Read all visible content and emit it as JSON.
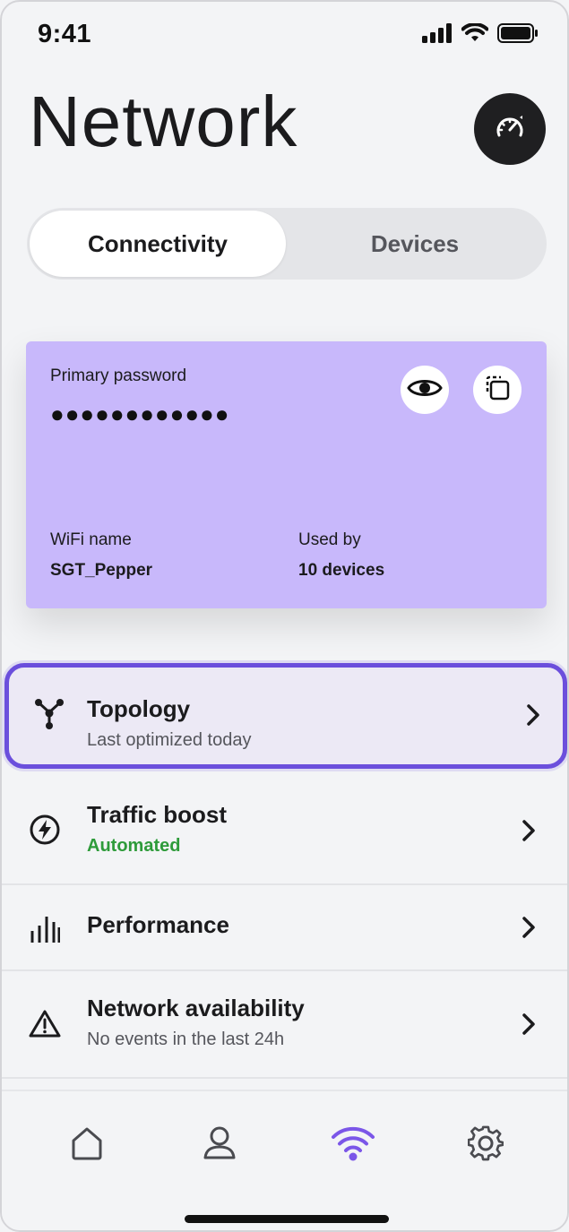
{
  "status_bar": {
    "time": "9:41",
    "signal_icon": "cellular-signal-icon",
    "wifi_icon": "wifi-icon",
    "battery_icon": "battery-icon"
  },
  "header": {
    "title": "Network",
    "speed_button_icon": "speedometer-icon"
  },
  "segmented": {
    "tabs": [
      {
        "label": "Connectivity",
        "active": true
      },
      {
        "label": "Devices",
        "active": false
      }
    ]
  },
  "password_card": {
    "background": "#c8b8fb",
    "password_label": "Primary password",
    "password_mask": "●●●●●●●●●●●●",
    "show_icon": "eye-icon",
    "copy_icon": "copy-icon",
    "wifi_name_label": "WiFi name",
    "wifi_name": "SGT_Pepper",
    "used_by_label": "Used by",
    "used_by_value": "10 devices"
  },
  "list": [
    {
      "id": "topology",
      "icon": "topology-icon",
      "title": "Topology",
      "subtitle": "Last optimized today",
      "subtitle_color": "#55565c",
      "selected": true
    },
    {
      "id": "traffic-boost",
      "icon": "lightning-icon",
      "title": "Traffic boost",
      "subtitle": "Automated",
      "subtitle_color": "#2e9b3a"
    },
    {
      "id": "performance",
      "icon": "bar-chart-icon",
      "title": "Performance"
    },
    {
      "id": "network-availability",
      "icon": "warning-icon",
      "title": "Network availability",
      "subtitle": "No events in the last 24h",
      "subtitle_color": "#55565c"
    }
  ],
  "tabbar": {
    "items": [
      {
        "icon": "home-icon"
      },
      {
        "icon": "person-icon"
      },
      {
        "icon": "wifi-icon",
        "active": true
      },
      {
        "icon": "gear-icon"
      }
    ],
    "accent": "#7b56e8"
  }
}
